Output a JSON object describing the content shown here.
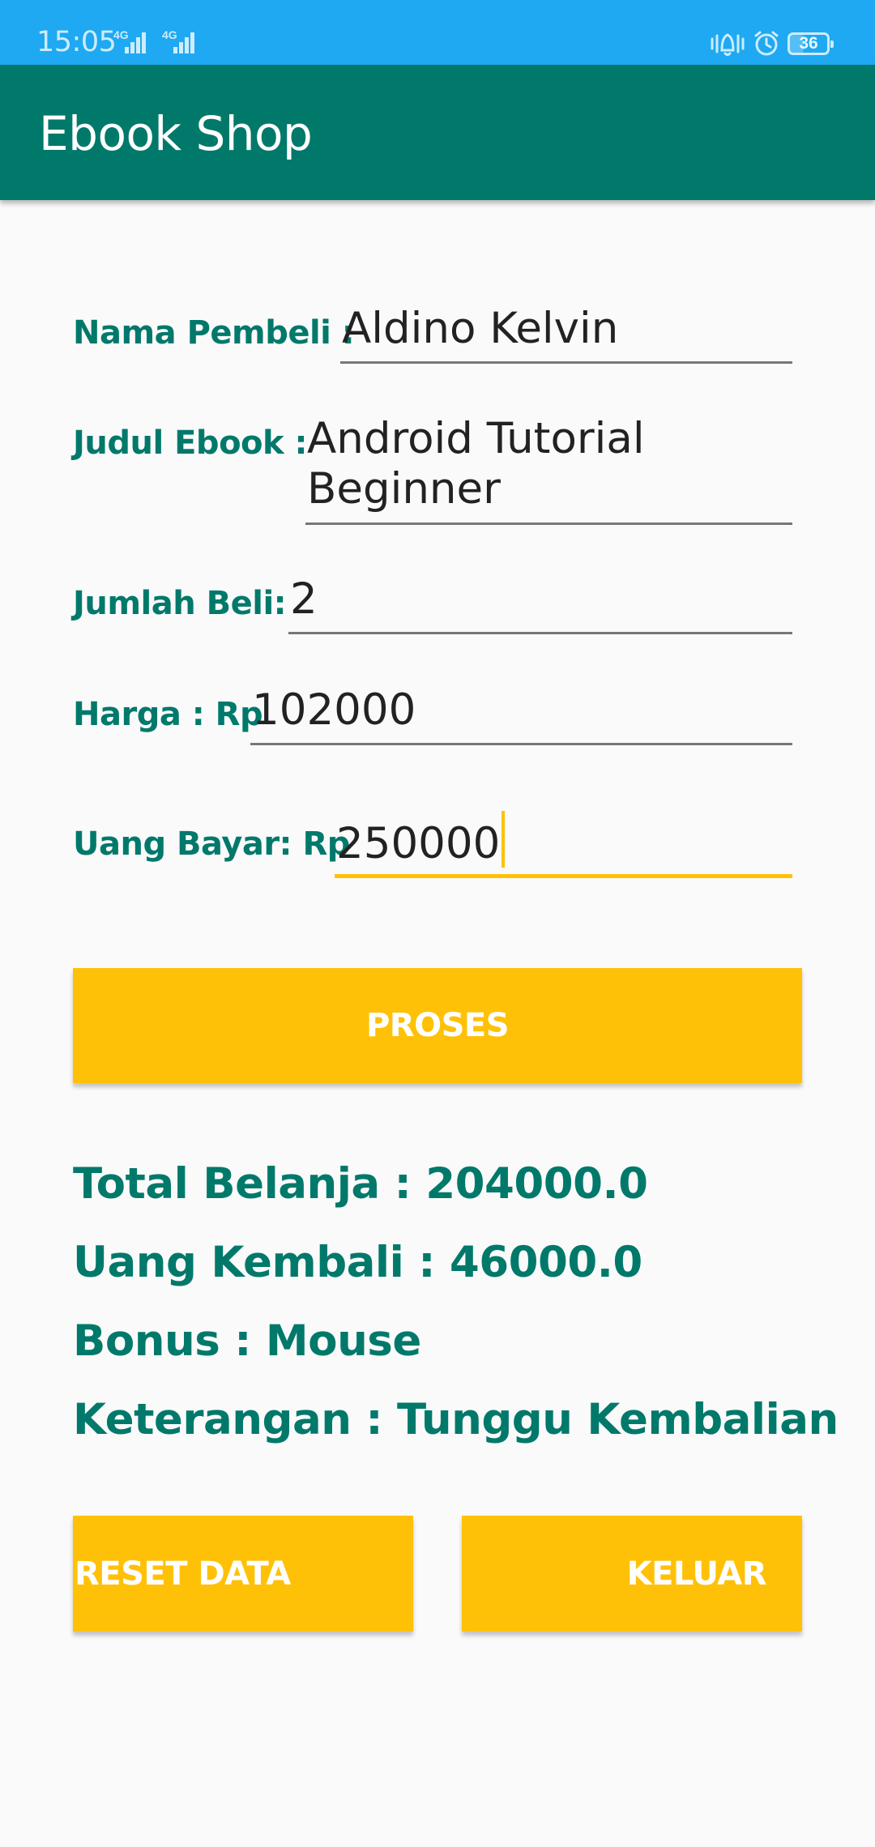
{
  "status_bar": {
    "time": "15:05",
    "signal_1_label": "4G",
    "signal_2_label": "4G",
    "battery": "36",
    "battery_level": 0.36,
    "icons": [
      "signal-icon",
      "signal-icon",
      "vibrate-icon",
      "alarm-icon",
      "battery-icon"
    ]
  },
  "app_bar": {
    "title": "Ebook Shop"
  },
  "form": {
    "nama_label": "Nama Pembeli :",
    "nama_value": "Aldino Kelvin",
    "judul_label": "Judul Ebook :",
    "judul_value": "Android Tutorial\nBeginner",
    "jumlah_label": "Jumlah Beli:",
    "jumlah_value": "2",
    "harga_label": "Harga : Rp",
    "harga_value": "102000",
    "uang_label": "Uang Bayar: Rp",
    "uang_value": "250000"
  },
  "buttons": {
    "proses": "PROSES",
    "reset": "RESET DATA",
    "keluar": "KELUAR"
  },
  "results": {
    "total": "Total Belanja : 204000.0",
    "kembali": "Uang Kembali : 46000.0",
    "bonus": "Bonus : Mouse",
    "keterangan": "Keterangan : Tunggu Kembalian"
  },
  "colors": {
    "status_bar": "#1ea9f2",
    "primary": "#00796b",
    "accent": "#ffc107",
    "background": "#fafafa"
  }
}
